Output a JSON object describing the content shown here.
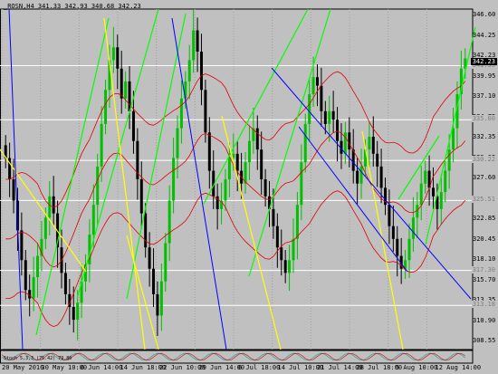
{
  "window": {
    "title": "_ROSN,H4  341.33 342.93 340.68 342.23",
    "current_price": "342.23",
    "indicator_label": "Stoch 5,3,3 (75.42) 79.80"
  },
  "y_axis": {
    "ticks": [
      "346.60",
      "344.25",
      "342.23",
      "339.95",
      "337.10",
      "334.75",
      "332.35",
      "329.95",
      "327.60",
      "325.20",
      "322.85",
      "320.45",
      "318.10",
      "315.70",
      "313.35",
      "310.90",
      "308.55"
    ]
  },
  "horizontal_lines": [
    "341.35",
    "335.00",
    "330.22",
    "325.51",
    "317.30",
    "313.18"
  ],
  "x_axis": {
    "ticks": [
      "20 May 2016",
      "30 May 10:00",
      "6 Jun 14:00",
      "14 Jun 18:00",
      "22 Jun 10:00",
      "29 Jun 14:00",
      "6 Jul 18:00",
      "14 Jul 10:00",
      "21 Jul 14:00",
      "28 Jul 18:00",
      "5 Aug 10:00",
      "12 Aug 14:00"
    ]
  },
  "chart_data": {
    "type": "candlestick",
    "title": "_ROSN,H4",
    "ylim": [
      308.0,
      348.0
    ],
    "last": {
      "open": 341.33,
      "high": 342.93,
      "low": 340.68,
      "close": 342.23
    },
    "horizontal_levels": [
      341.35,
      335.0,
      330.22,
      325.51,
      317.3,
      313.18
    ],
    "series": [
      {
        "name": "close",
        "values": [
          330.5,
          328.0,
          325.5,
          322.0,
          318.5,
          315.0,
          314.0,
          316.5,
          319.0,
          321.0,
          323.5,
          326.0,
          324.0,
          320.0,
          317.0,
          314.5,
          313.0,
          311.5,
          313.5,
          316.0,
          318.0,
          321.5,
          325.0,
          329.5,
          334.5,
          338.5,
          342.0,
          343.5,
          341.0,
          337.5,
          339.5,
          336.0,
          332.5,
          328.0,
          324.0,
          320.0,
          317.5,
          314.5,
          312.0,
          316.0,
          320.5,
          325.5,
          330.5,
          334.0,
          337.5,
          339.5,
          342.0,
          345.5,
          343.0,
          338.5,
          333.5,
          329.0,
          326.0,
          324.5,
          325.5,
          328.0,
          330.5,
          331.0,
          329.0,
          327.5,
          330.0,
          332.5,
          334.0,
          331.5,
          328.0,
          326.0,
          324.5,
          322.5,
          320.0,
          318.5,
          317.0,
          318.5,
          321.0,
          325.0,
          330.0,
          334.5,
          338.0,
          340.0,
          339.0,
          336.0,
          334.5,
          336.0,
          335.0,
          332.5,
          331.0,
          333.5,
          331.5,
          329.0,
          327.5,
          329.5,
          331.5,
          333.0,
          331.0,
          329.5,
          327.0,
          325.0,
          322.5,
          321.0,
          319.0,
          317.5,
          318.5,
          321.0,
          323.5,
          325.0,
          327.5,
          329.0,
          327.0,
          326.0,
          324.5,
          326.5,
          329.0,
          331.5,
          334.0,
          338.0,
          341.0,
          342.2
        ]
      },
      {
        "name": "bollinger-upper",
        "values": []
      },
      {
        "name": "bollinger-lower",
        "values": []
      }
    ],
    "stochastic": {
      "k": 75.42,
      "d": 79.8,
      "params": "5,3,3"
    }
  },
  "colors": {
    "background": "#c0c0c0",
    "grid_line": "#ffffff",
    "bull_candle": "#00c000",
    "bear_candle": "#000000",
    "bollinger": "#e00000",
    "green_trendline": "#00ff00",
    "yellow_trendline": "#ffff00",
    "blue_trendline": "#0000ff"
  }
}
